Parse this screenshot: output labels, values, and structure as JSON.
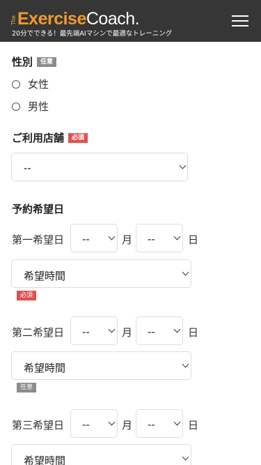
{
  "header": {
    "logo_the": "The",
    "logo_exercise": "Exercise",
    "logo_coach": "Coach.",
    "tagline": "20分でできる！最先端AIマシンで最適なトレーニング"
  },
  "gender": {
    "title": "性別",
    "badge": "任意",
    "options": [
      "女性",
      "男性"
    ]
  },
  "store": {
    "title": "ご利用店舗",
    "badge": "必須",
    "selected": "--"
  },
  "reservation": {
    "title": "予約希望日",
    "month_unit": "月",
    "day_unit": "日",
    "choices": [
      {
        "label": "第一希望日",
        "month": "--",
        "day": "--",
        "time": "希望時間",
        "badge": "必須"
      },
      {
        "label": "第二希望日",
        "month": "--",
        "day": "--",
        "time": "希望時間",
        "badge": "任意"
      },
      {
        "label": "第三希望日",
        "month": "--",
        "day": "--",
        "time": "希望時間",
        "badge": ""
      }
    ]
  },
  "colors": {
    "header_bg": "#363636",
    "brand_orange": "#f29a2e",
    "required_badge": "#e05050",
    "optional_badge": "#8c8c8c"
  }
}
